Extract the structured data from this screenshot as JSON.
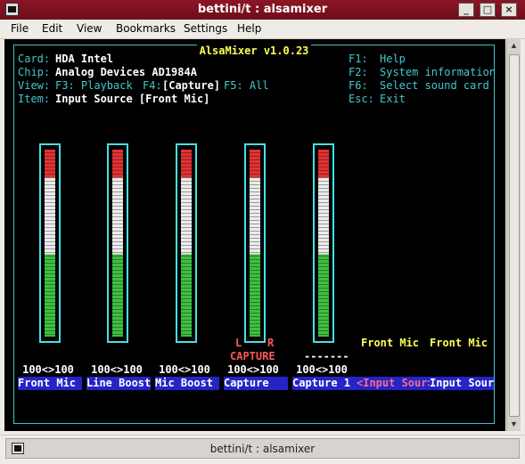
{
  "window": {
    "title": "bettini/t : alsamixer",
    "min": "_",
    "max": "□",
    "close": "×"
  },
  "menu": [
    "File",
    "Edit",
    "View",
    "Bookmarks",
    "Settings",
    "Help"
  ],
  "mixer": {
    "title": "AlsaMixer v1.0.23",
    "card_label": "Card:",
    "card_value": "HDA Intel",
    "chip_label": "Chip:",
    "chip_value": "Analog Devices AD1984A",
    "view_label": "View:",
    "view_f3": "F3: Playback",
    "view_f4": "F4:",
    "view_f4_value": "[Capture]",
    "view_f5": "F5: All",
    "item_label": "Item:",
    "item_value": "Input Source [Front Mic]",
    "help": [
      {
        "key": "F1:",
        "text": "Help"
      },
      {
        "key": "F2:",
        "text": "System information"
      },
      {
        "key": "F6:",
        "text": "Select sound card"
      },
      {
        "key": "Esc:",
        "text": "Exit"
      }
    ],
    "controls": [
      {
        "name": "Front Mic",
        "value": "100<>100",
        "level": 1.0
      },
      {
        "name": "Line Boost",
        "value": "100<>100",
        "level": 1.0
      },
      {
        "name": "Mic Boost",
        "value": "100<>100",
        "level": 1.0
      },
      {
        "name": "Capture",
        "value": "100<>100",
        "level": 1.0,
        "left": "L",
        "right": "R",
        "tag": "CAPTURE"
      },
      {
        "name": "Capture 1",
        "value": "100<>100",
        "level": 1.0,
        "tag": "-------"
      }
    ],
    "enums": [
      {
        "name": "<Input Sour>",
        "value": "Front Mic"
      },
      {
        "name": "Input Sour",
        "value": "Front Mic"
      }
    ]
  },
  "taskbar": {
    "label": "bettini/t : alsamixer"
  },
  "colors": {
    "frame": "#3fc4c9",
    "label_bg": "#2424c8",
    "title": "#ffff55",
    "selected": "#ff5555"
  }
}
